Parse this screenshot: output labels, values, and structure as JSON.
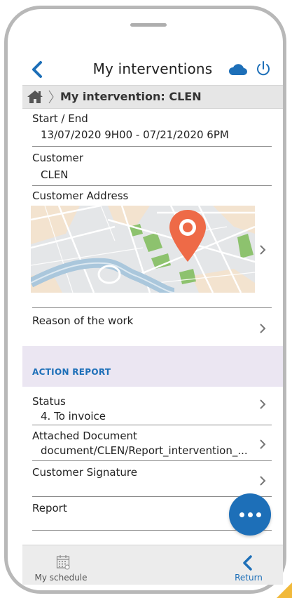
{
  "header": {
    "title": "My interventions"
  },
  "breadcrumb": {
    "current": "My intervention: CLEN"
  },
  "fields": {
    "start_end": {
      "label": "Start / End",
      "value": "13/07/2020 9H00 - 07/21/2020 6PM"
    },
    "customer": {
      "label": "Customer",
      "value": "CLEN"
    },
    "customer_address": {
      "label": "Customer Address"
    },
    "reason": {
      "label": "Reason of the work"
    }
  },
  "action_report": {
    "title": "ACTION REPORT",
    "status": {
      "label": "Status",
      "value": "4. To invoice"
    },
    "attached_document": {
      "label": "Attached Document",
      "value": "document/CLEN/Report_intervention_..."
    },
    "customer_signature": {
      "label": "Customer Signature"
    },
    "report": {
      "label": "Report"
    }
  },
  "bottom_bar": {
    "schedule_label": "My schedule",
    "return_label": "Return"
  },
  "colors": {
    "accent": "#1d6fb8",
    "action_band": "#ebe6f2",
    "pin": "#ee6a47"
  },
  "icons": [
    "back-arrow-icon",
    "cloud-icon",
    "power-icon",
    "home-icon",
    "chevron-right-icon",
    "map-pin-icon",
    "calendar-icon",
    "more-dots-icon"
  ]
}
